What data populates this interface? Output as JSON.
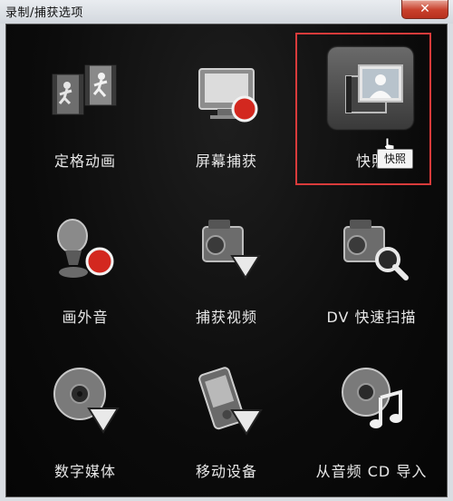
{
  "window": {
    "title": "录制/捕获选项",
    "close_glyph": "✕"
  },
  "options": [
    {
      "id": "stop-motion",
      "label": "定格动画",
      "icon": "stop-motion-icon"
    },
    {
      "id": "screen-capture",
      "label": "屏幕捕获",
      "icon": "screen-capture-icon"
    },
    {
      "id": "snapshot",
      "label": "快照",
      "icon": "snapshot-icon",
      "selected": true
    },
    {
      "id": "voiceover",
      "label": "画外音",
      "icon": "microphone-record-icon"
    },
    {
      "id": "capture-video",
      "label": "捕获视频",
      "icon": "camcorder-capture-icon"
    },
    {
      "id": "dv-quick-scan",
      "label": "DV 快速扫描",
      "icon": "camcorder-scan-icon"
    },
    {
      "id": "digital-media",
      "label": "数字媒体",
      "icon": "disc-import-icon"
    },
    {
      "id": "mobile-device",
      "label": "移动设备",
      "icon": "mobile-device-icon"
    },
    {
      "id": "import-audio-cd",
      "label": "从音频 CD 导入",
      "icon": "audio-cd-icon"
    }
  ],
  "tooltip": {
    "text": "快照"
  },
  "colors": {
    "panel_background": "#0b0b0b",
    "label_text": "#e8e8e8",
    "record_red": "#d3281f",
    "highlight_border": "#d93b3b"
  }
}
